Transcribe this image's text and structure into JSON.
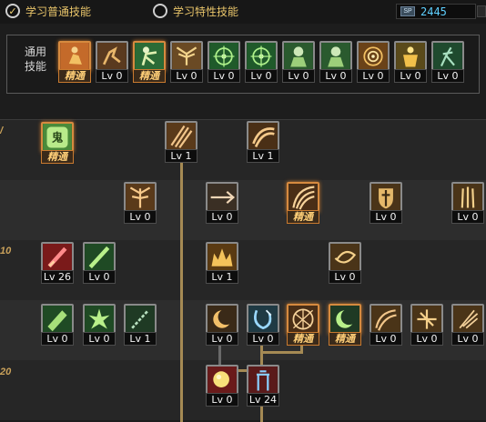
{
  "tabs": {
    "normal": {
      "label": "学习普通技能",
      "selected": true
    },
    "special": {
      "label": "学习特性技能",
      "selected": false
    }
  },
  "skill_points": {
    "icon_label": "SP",
    "value": "2445"
  },
  "common": {
    "label_line1": "通用",
    "label_line2": "技能",
    "skills": [
      {
        "badge": "精通",
        "mastered": true,
        "icon": "figure-sitting-icon",
        "bg": "#c46a2a"
      },
      {
        "badge": "Lv 0",
        "mastered": false,
        "icon": "figure-leap-icon",
        "bg": "#5a3a1f"
      },
      {
        "badge": "精通",
        "mastered": true,
        "icon": "figure-kick-icon",
        "bg": "#2b6b36"
      },
      {
        "badge": "Lv 0",
        "mastered": false,
        "icon": "wings-icon",
        "bg": "#6a4a24"
      },
      {
        "badge": "Lv 0",
        "mastered": false,
        "icon": "crosshair-icon",
        "bg": "#1f5a2a"
      },
      {
        "badge": "Lv 0",
        "mastered": false,
        "icon": "crosshair-icon",
        "bg": "#1f5a2a"
      },
      {
        "badge": "Lv 0",
        "mastered": false,
        "icon": "figure-helmet-icon",
        "bg": "#2a5a2e"
      },
      {
        "badge": "Lv 0",
        "mastered": false,
        "icon": "figure-helmet-icon",
        "bg": "#2a5a2e"
      },
      {
        "badge": "Lv 0",
        "mastered": false,
        "icon": "vortex-icon",
        "bg": "#6a4218"
      },
      {
        "badge": "Lv 0",
        "mastered": false,
        "icon": "figure-golden-icon",
        "bg": "#5a4a1a"
      },
      {
        "badge": "Lv 0",
        "mastered": false,
        "icon": "figure-stance-icon",
        "bg": "#1f4a2e"
      }
    ]
  },
  "level_marks": [
    "10",
    "20"
  ],
  "tree": {
    "row0": [
      {
        "badge": "精通",
        "mastered": true,
        "icon": "demon-mask-icon",
        "glyph": "鬼",
        "bg": "#4a8a3a"
      },
      {
        "badge": "Lv 1",
        "mastered": false,
        "icon": "claw-slash-icon",
        "bg": "#5a3a1a"
      },
      {
        "badge": "Lv 1",
        "mastered": false,
        "icon": "arc-slash-icon",
        "bg": "#4a2f16"
      }
    ],
    "row1": [
      {
        "badge": "Lv 0",
        "mastered": false,
        "icon": "winged-blade-icon",
        "bg": "#5a3a1a"
      },
      {
        "badge": "Lv 0",
        "mastered": false,
        "icon": "thrust-icon",
        "bg": "#3a2f24"
      },
      {
        "badge": "精通",
        "mastered": true,
        "icon": "triple-arc-icon",
        "bg": "#4a2e16"
      },
      {
        "badge": "Lv 0",
        "mastered": false,
        "icon": "shield-sword-icon",
        "bg": "#4a3418"
      },
      {
        "badge": "Lv 0",
        "mastered": false,
        "icon": "triple-blade-icon",
        "bg": "#4a3418"
      }
    ],
    "row2": [
      {
        "badge": "Lv 26",
        "mastered": false,
        "icon": "red-sword-icon",
        "bg": "#7a1a1a"
      },
      {
        "badge": "Lv 0",
        "mastered": false,
        "icon": "green-blade-icon",
        "bg": "#1f4a24"
      },
      {
        "badge": "Lv 1",
        "mastered": false,
        "icon": "flame-crown-icon",
        "bg": "#5a3a12"
      },
      {
        "badge": "Lv 0",
        "mastered": false,
        "icon": "spiral-blade-icon",
        "bg": "#4a3418"
      }
    ],
    "row3": [
      {
        "badge": "Lv 0",
        "mastered": false,
        "icon": "green-slab-icon",
        "bg": "#1f4a24"
      },
      {
        "badge": "Lv 0",
        "mastered": false,
        "icon": "green-burst-icon",
        "bg": "#1f4a24"
      },
      {
        "badge": "Lv 1",
        "mastered": false,
        "icon": "green-chain-icon",
        "bg": "#1f3a24"
      },
      {
        "badge": "Lv 0",
        "mastered": false,
        "icon": "crescent-icon",
        "bg": "#3a2a18"
      },
      {
        "badge": "Lv 0",
        "mastered": false,
        "icon": "blue-hook-icon",
        "bg": "#1f3a44"
      },
      {
        "badge": "精通",
        "mastered": true,
        "icon": "sunburst-icon",
        "bg": "#4a2e16"
      },
      {
        "badge": "精通",
        "mastered": true,
        "icon": "green-crescent-icon",
        "bg": "#1f3a24"
      },
      {
        "badge": "Lv 0",
        "mastered": false,
        "icon": "swirl-cut-icon",
        "bg": "#4a3418"
      },
      {
        "badge": "Lv 0",
        "mastered": false,
        "icon": "cross-slash-icon",
        "bg": "#4a3418"
      },
      {
        "badge": "Lv 0",
        "mastered": false,
        "icon": "feather-blade-icon",
        "bg": "#4a3418"
      }
    ],
    "row4": [
      {
        "badge": "Lv 0",
        "mastered": false,
        "icon": "yellow-orb-icon",
        "bg": "#6a1a1a"
      },
      {
        "badge": "Lv 24",
        "mastered": false,
        "icon": "blue-tower-icon",
        "bg": "#5a1a1a"
      }
    ]
  }
}
